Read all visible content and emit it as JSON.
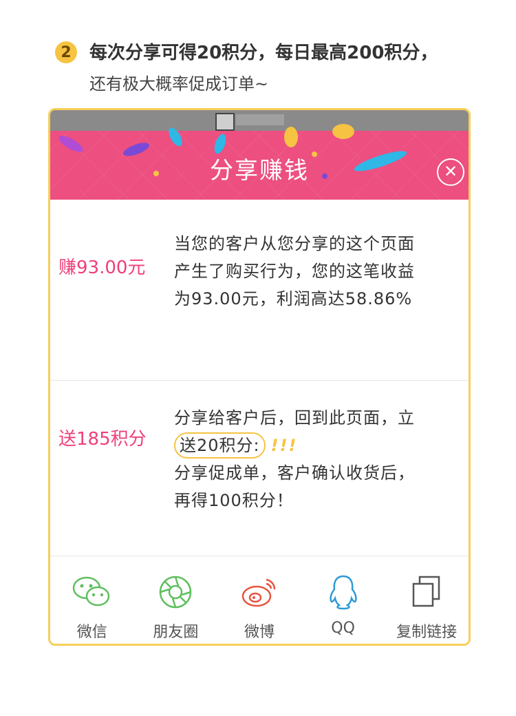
{
  "step": {
    "number": "2",
    "line1": "每次分享可得20积分，每日最高200积分，",
    "line2": "还有极大概率促成订单~"
  },
  "modal": {
    "title": "分享赚钱",
    "close_icon": "close-circle-icon",
    "rows": [
      {
        "label": "赚93.00元",
        "lines": [
          "当您的客户从您分享的这个页面",
          "产生了购买行为，您的这笔收益",
          "为93.00元，利润高达58.86%"
        ]
      },
      {
        "label": "送185积分",
        "line1": "分享给客户后，回到此页面，立",
        "circled": "送20积分:",
        "exclaim": "!!!",
        "line3": "分享促成单，客户确认收货后，",
        "line4": "再得100积分！"
      }
    ],
    "share_options": [
      {
        "label": "微信",
        "icon": "wechat-icon",
        "color": "#5fbf5f"
      },
      {
        "label": "朋友圈",
        "icon": "moments-icon",
        "color": "#5fbf5f"
      },
      {
        "label": "微博",
        "icon": "weibo-icon",
        "color": "#e8523f"
      },
      {
        "label": "QQ",
        "icon": "qq-icon",
        "color": "#2d9ad6"
      },
      {
        "label": "复制链接",
        "icon": "copy-link-icon",
        "color": "#555555"
      }
    ]
  },
  "colors": {
    "accent": "#f6c343",
    "banner": "#ec4f80",
    "label": "#ee3f7a"
  }
}
